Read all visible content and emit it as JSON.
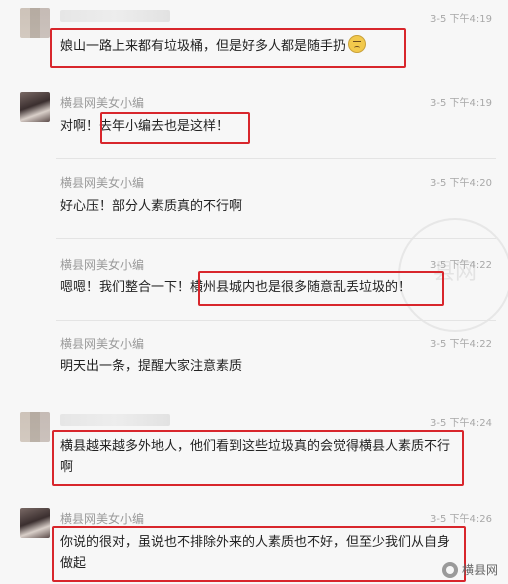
{
  "messages": [
    {
      "name": "",
      "time": "3-5 下午4:19",
      "text": "娘山一路上来都有垃圾桶，但是好多人都是随手扔",
      "emoji": "pensive-face"
    },
    {
      "name": "横县网美女小编",
      "time": "3-5 下午4:19",
      "text_a": "对啊！",
      "text_b": "去年小编去也是这样！"
    },
    {
      "name": "横县网美女小编",
      "time": "3-5 下午4:20",
      "text": "好心压！部分人素质真的不行啊"
    },
    {
      "name": "横县网美女小编",
      "time": "3-5 下午4:22",
      "text_a": "嗯嗯！我们整合一下！",
      "text_b": "横州县城内也是很多随意乱丢垃圾的！"
    },
    {
      "name": "横县网美女小编",
      "time": "3-5 下午4:22",
      "text": "明天出一条，提醒大家注意素质"
    },
    {
      "name": "",
      "time": "3-5 下午4:24",
      "text": "横县越来越多外地人，他们看到这些垃圾真的会觉得横县人素质不行啊"
    },
    {
      "name": "横县网美女小编",
      "time": "3-5 下午4:26",
      "text": "你说的很对，虽说也不排除外来的人素质也不好，但至少我们从自身做起"
    }
  ],
  "watermark": "县网",
  "brand": "横县网",
  "colors": {
    "highlight": "#d8262c",
    "name": "#9a9a9a",
    "text": "#222222"
  }
}
